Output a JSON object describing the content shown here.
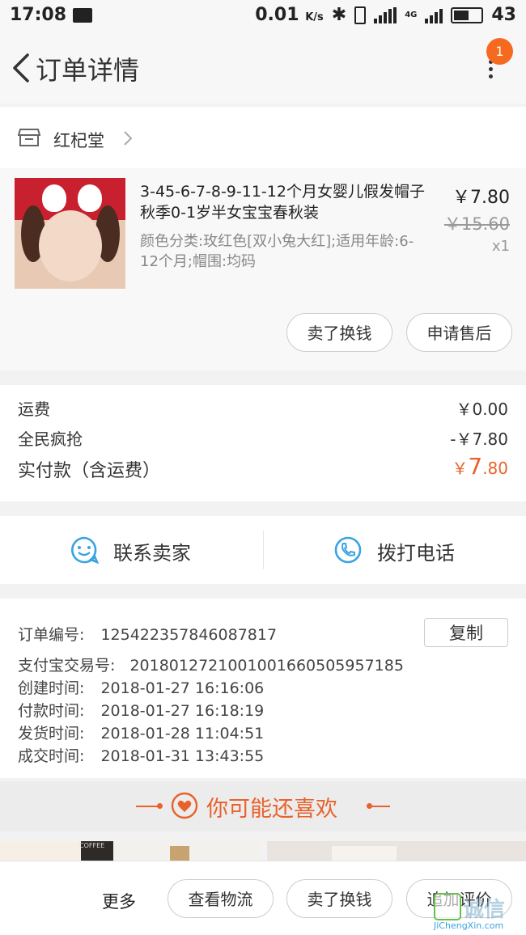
{
  "status_bar": {
    "time": "17:08",
    "speed": "0.01",
    "speed_unit": "K/s",
    "network": "4G",
    "battery": "43"
  },
  "header": {
    "title": "订单详情",
    "notification_count": "1"
  },
  "shop": {
    "name": "红杞堂"
  },
  "item": {
    "title": "3-45-6-7-8-9-11-12个月女婴儿假发帽子秋季0-1岁半女宝宝春秋装",
    "spec": "颜色分类:玫红色[双小兔大红];适用年龄:6-12个月;帽围:均码",
    "price": "￥7.80",
    "original_price": "￥15.60",
    "quantity": "x1",
    "buttons": [
      "卖了换钱",
      "申请售后"
    ]
  },
  "fees": {
    "shipping_label": "运费",
    "shipping_value": "￥0.00",
    "discount_label": "全民疯抢",
    "discount_value": "-￥7.80",
    "paid_label": "实付款（含运费）",
    "paid_currency": "￥",
    "paid_int": "7",
    "paid_dec": ".80"
  },
  "contact": {
    "seller_label": "联系卖家",
    "phone_label": "拨打电话"
  },
  "order_info": {
    "rows": [
      {
        "key": "订单编号:",
        "value": "125422357846087817"
      },
      {
        "key": "支付宝交易号:",
        "value": "2018012721001001660505957185"
      },
      {
        "key": "创建时间:",
        "value": "2018-01-27 16:16:06"
      },
      {
        "key": "付款时间:",
        "value": "2018-01-27 16:18:19"
      },
      {
        "key": "发货时间:",
        "value": "2018-01-28 11:04:51"
      },
      {
        "key": "成交时间:",
        "value": "2018-01-31 13:43:55"
      }
    ],
    "copy_label": "复制"
  },
  "recommend": {
    "title": "你可能还喜欢",
    "card_text": "COFFEE"
  },
  "bottom_bar": {
    "more": "更多",
    "buttons": [
      "查看物流",
      "卖了换钱",
      "追加评价"
    ]
  },
  "watermark": {
    "text": "诚信",
    "subtext": "JiChengXin.com"
  },
  "colors": {
    "accent": "#e8622c",
    "badge": "#f56a1e",
    "icon_blue": "#3aa3e3"
  }
}
